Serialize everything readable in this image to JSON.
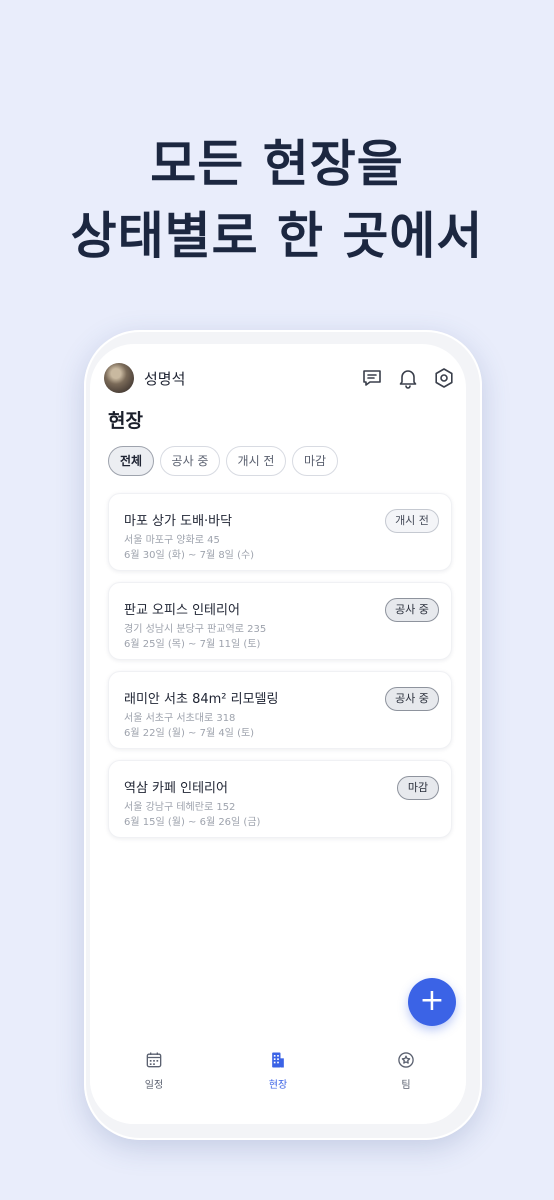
{
  "headline": {
    "line1": "모든 현장을",
    "line2": "상태별로 한 곳에서"
  },
  "header": {
    "username": "성명석"
  },
  "page": {
    "title": "현장"
  },
  "filters": [
    "전체",
    "공사 중",
    "개시 전",
    "마감"
  ],
  "sites": [
    {
      "title": "마포 상가 도배·바닥",
      "address": "서울 마포구 양화로 45",
      "dates": "6월 30일 (화) ~ 7월 8일 (수)",
      "status": "개시 전"
    },
    {
      "title": "판교 오피스 인테리어",
      "address": "경기 성남시 분당구 판교역로 235",
      "dates": "6월 25일 (목) ~ 7월 11일 (토)",
      "status": "공사 중"
    },
    {
      "title": "래미안 서초 84m² 리모델링",
      "address": "서울 서초구 서초대로 318",
      "dates": "6월 22일 (월) ~ 7월 4일 (토)",
      "status": "공사 중"
    },
    {
      "title": "역삼 카페 인테리어",
      "address": "서울 강남구 테헤란로 152",
      "dates": "6월 15일 (월) ~ 6월 26일 (금)",
      "status": "마감"
    }
  ],
  "fab": {
    "icon": "plus-icon",
    "label": "+"
  },
  "nav": [
    {
      "label": "일정",
      "icon": "calendar-icon"
    },
    {
      "label": "현장",
      "icon": "building-icon"
    },
    {
      "label": "팀",
      "icon": "badge-icon"
    }
  ],
  "colors": {
    "accent": "#3b63e6",
    "background": "#e9edfb",
    "headline": "#1c2740"
  }
}
